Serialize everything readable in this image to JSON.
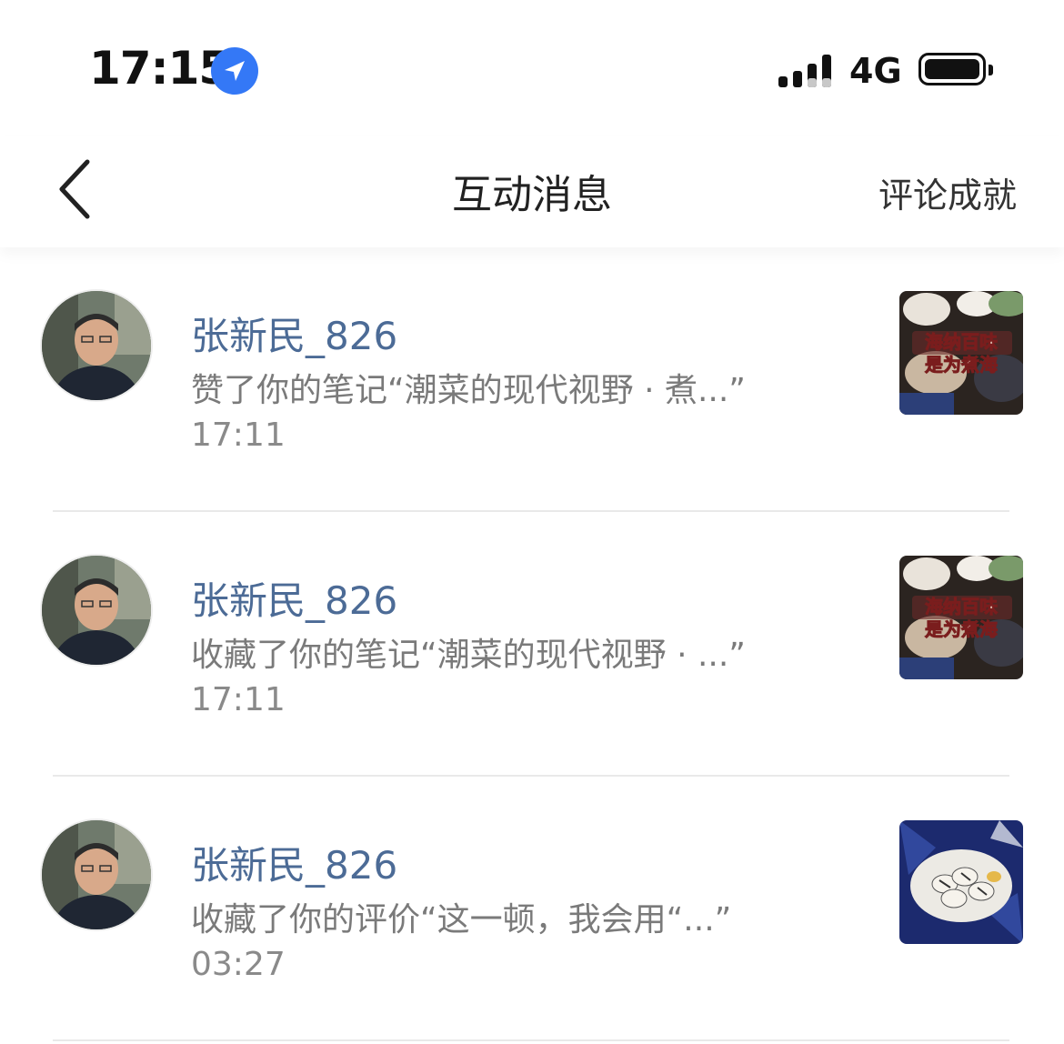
{
  "status": {
    "time": "17:15",
    "network": "4G"
  },
  "nav": {
    "title": "互动消息",
    "right_label": "评论成就"
  },
  "items": [
    {
      "user": "张新民_826",
      "action": "赞了你的笔记“潮菜的现代视野 · 煮...”",
      "time": "17:11",
      "thumb_caption": [
        "海纳百味",
        "是为煮海"
      ]
    },
    {
      "user": "张新民_826",
      "action": "收藏了你的笔记“潮菜的现代视野 · ...”",
      "time": "17:11",
      "thumb_caption": [
        "海纳百味",
        "是为煮海"
      ]
    },
    {
      "user": "张新民_826",
      "action": "收藏了你的评价“这一顿，我会用“...”",
      "time": "03:27"
    }
  ],
  "colors": {
    "username": "#4c6b96",
    "location_badge": "#3478f6"
  }
}
